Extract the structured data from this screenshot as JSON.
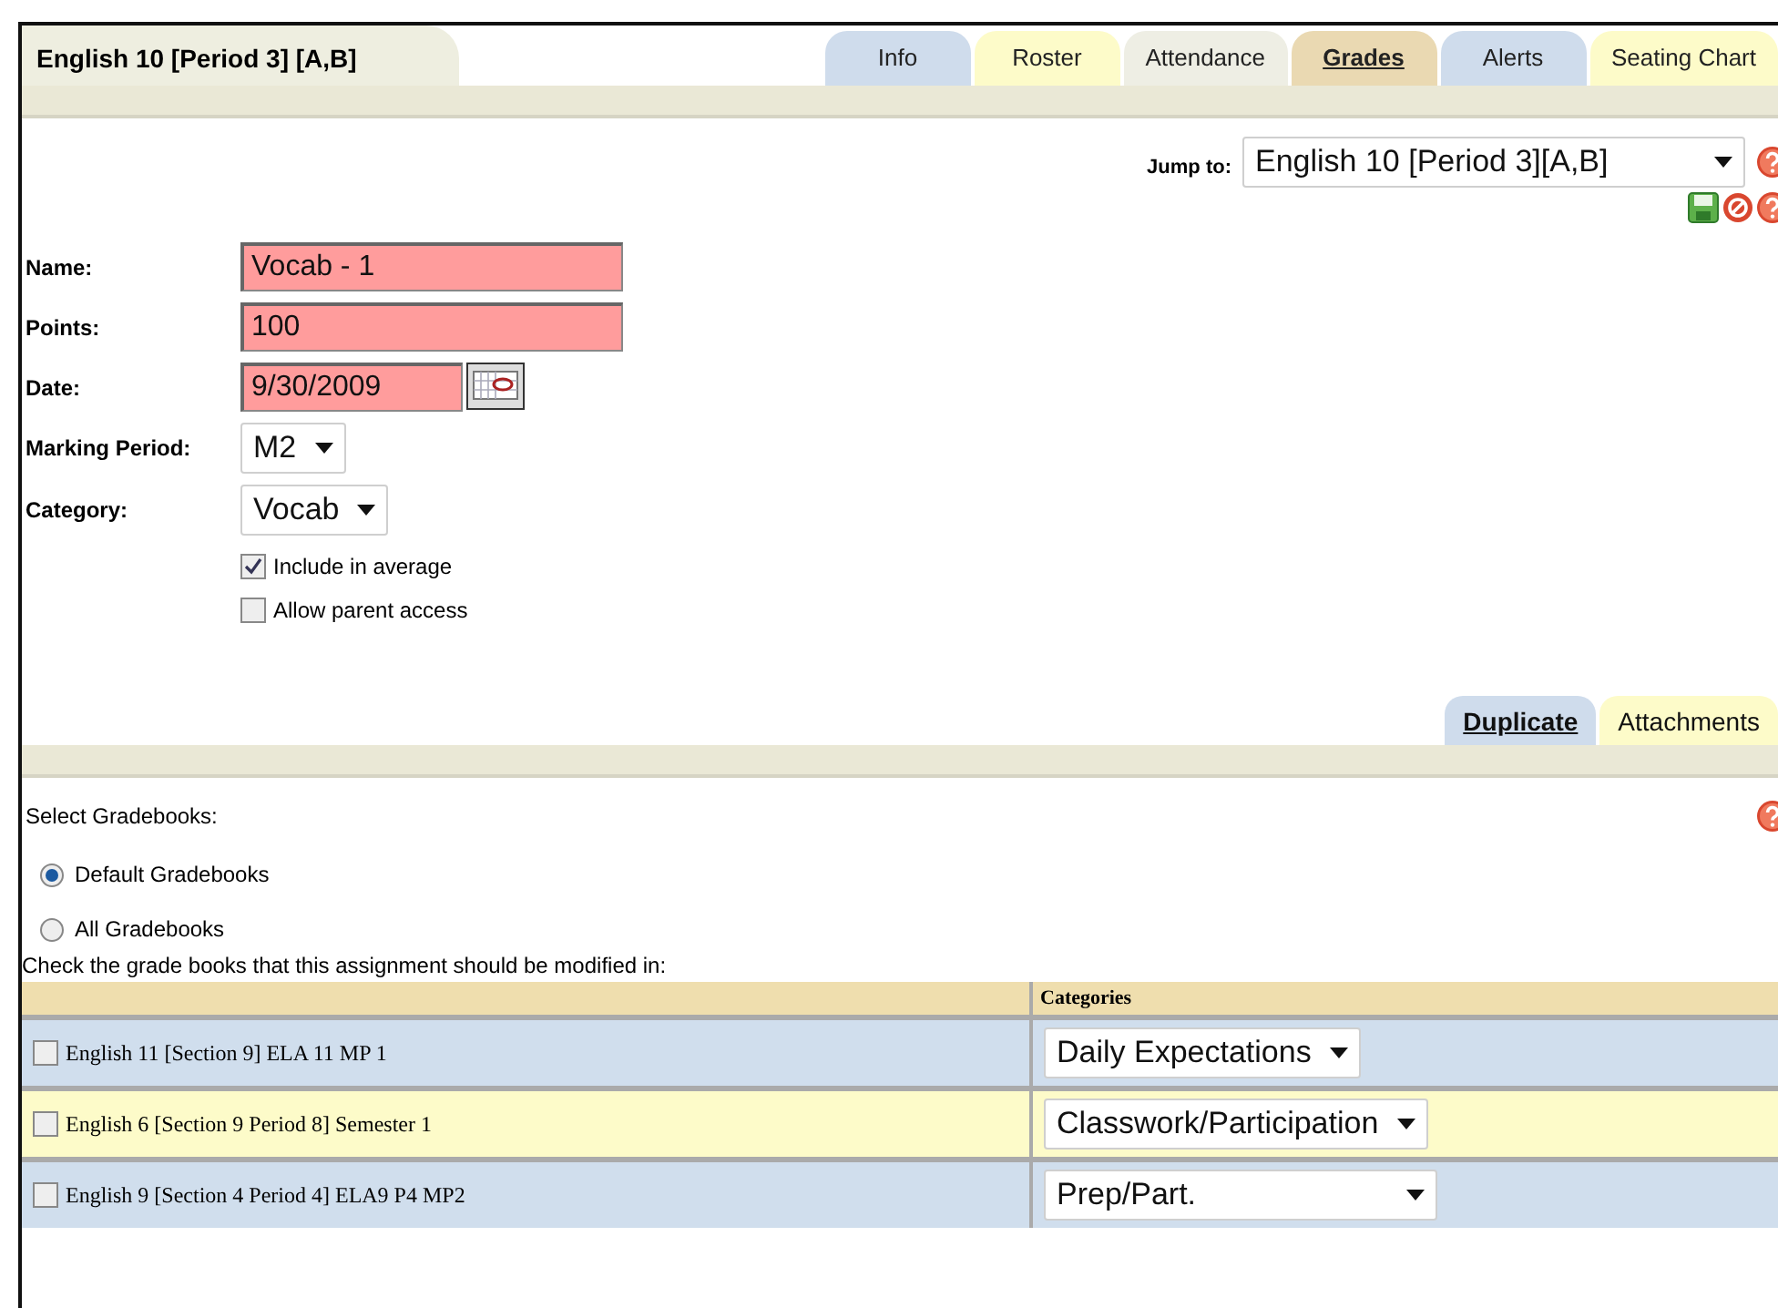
{
  "header": {
    "title": "English 10 [Period 3] [A,B]"
  },
  "tabs": [
    {
      "label": "Info",
      "selected": false,
      "color": "#cfdcec"
    },
    {
      "label": "Roster",
      "selected": false,
      "color": "#fdfbc9"
    },
    {
      "label": "Attendance",
      "selected": false,
      "color": "#eeeee4"
    },
    {
      "label": "Grades",
      "selected": true,
      "color": "#ead9b2"
    },
    {
      "label": "Alerts",
      "selected": false,
      "color": "#cfdcec"
    },
    {
      "label": "Seating Chart",
      "selected": false,
      "color": "#fdfbc9"
    }
  ],
  "jump_to": {
    "label": "Jump to:",
    "value": "English 10 [Period 3][A,B]"
  },
  "form": {
    "name": {
      "label": "Name:",
      "value": "Vocab - 1"
    },
    "points": {
      "label": "Points:",
      "value": "100"
    },
    "date": {
      "label": "Date:",
      "value": "9/30/2009"
    },
    "marking_period": {
      "label": "Marking Period:",
      "value": "M2"
    },
    "category": {
      "label": "Category:",
      "value": "Vocab"
    },
    "checkboxes": [
      {
        "label": "Include in average",
        "checked": true
      },
      {
        "label": "Allow parent access",
        "checked": false
      }
    ]
  },
  "sub_tabs": [
    {
      "label": "Duplicate",
      "selected": true,
      "color": "#cfdcec"
    },
    {
      "label": "Attachments",
      "selected": false,
      "color": "#fdfbc9"
    }
  ],
  "gradebooks": {
    "heading": "Select Gradebooks:",
    "options": [
      {
        "label": "Default Gradebooks",
        "selected": true
      },
      {
        "label": "All Gradebooks",
        "selected": false
      }
    ],
    "instruction": "Check the grade books that this assignment should be modified in:",
    "columns": [
      "Categories"
    ],
    "rows": [
      {
        "name": "English 11 [Section 9] ELA 11 MP 1",
        "checked": false,
        "category": "Daily Expectations"
      },
      {
        "name": "English 6 [Section 9 Period 8] Semester 1",
        "checked": false,
        "category": "Classwork/Participation"
      },
      {
        "name": "English 9 [Section 4 Period 4] ELA9 P4 MP2",
        "checked": false,
        "category": "Prep/Part."
      }
    ]
  }
}
